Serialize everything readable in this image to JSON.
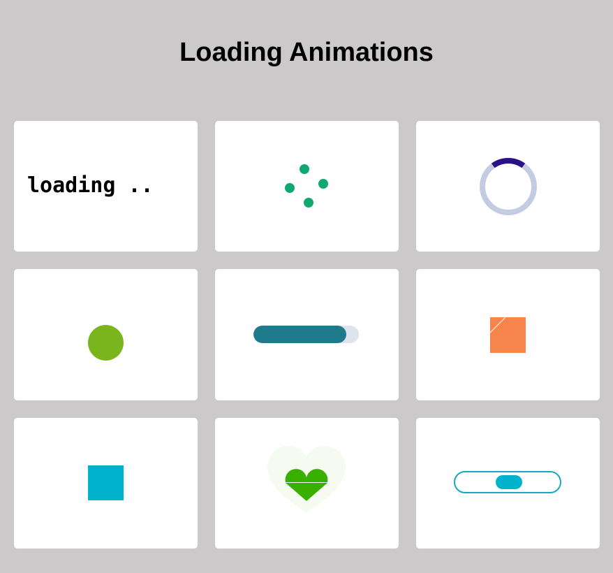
{
  "page": {
    "title": "Loading Animations"
  },
  "loaders": [
    {
      "id": "text-loader",
      "text": "loading ..",
      "color": "#000000"
    },
    {
      "id": "dots-loader",
      "color": "#0fa870",
      "dot_count": 4
    },
    {
      "id": "ring-spinner",
      "track_color": "#c3cce0",
      "arc_color": "#2b1188"
    },
    {
      "id": "pulse-circle",
      "color": "#7ab51d"
    },
    {
      "id": "progress-bar",
      "fill_color": "#1f7a8c",
      "track_color": "#dfe3ee",
      "progress": 0.88
    },
    {
      "id": "flip-square",
      "color": "#f7844b"
    },
    {
      "id": "cyan-square",
      "color": "#00b2cc"
    },
    {
      "id": "heart-loader",
      "color": "#39b000",
      "glow_color": "#f6fbf1"
    },
    {
      "id": "toggle-loader",
      "border_color": "#1aa6bd",
      "knob_color": "#00b2cc"
    }
  ],
  "colors": {
    "background": "#cbc9ca",
    "card": "#ffffff"
  }
}
